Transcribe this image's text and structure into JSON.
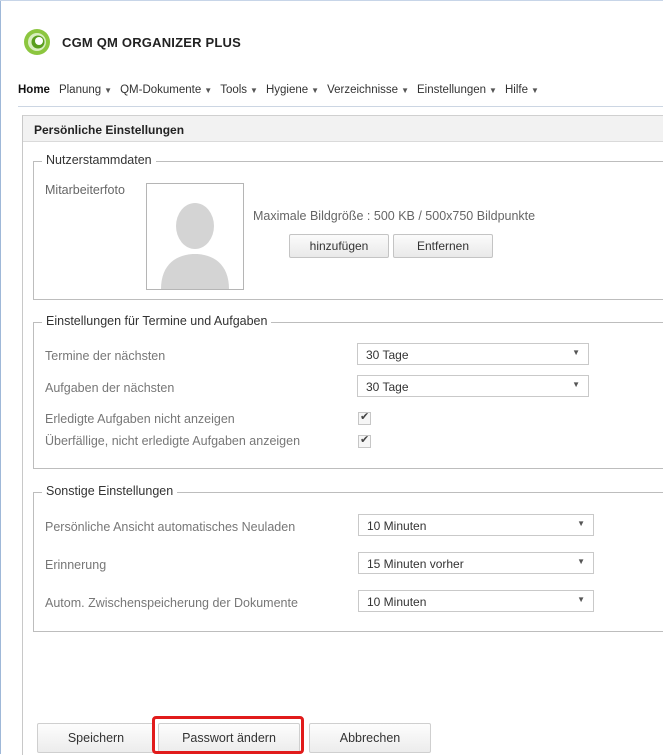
{
  "app": {
    "title": "CGM QM ORGANIZER PLUS"
  },
  "nav": [
    {
      "label": "Home",
      "has_menu": false
    },
    {
      "label": "Planung",
      "has_menu": true
    },
    {
      "label": "QM-Dokumente",
      "has_menu": true
    },
    {
      "label": "Tools",
      "has_menu": true
    },
    {
      "label": "Hygiene",
      "has_menu": true
    },
    {
      "label": "Verzeichnisse",
      "has_menu": true
    },
    {
      "label": "Einstellungen",
      "has_menu": true
    },
    {
      "label": "Hilfe",
      "has_menu": true
    }
  ],
  "panel": {
    "title": "Persönliche Einstellungen"
  },
  "user_data": {
    "legend": "Nutzerstammdaten",
    "photo_label": "Mitarbeiterfoto",
    "hint": "Maximale Bildgröße : 500 KB / 500x750 Bildpunkte",
    "add_button": "hinzufügen",
    "remove_button": "Entfernen"
  },
  "tasks": {
    "legend": "Einstellungen für Termine und Aufgaben",
    "appointments_label": "Termine der nächsten",
    "appointments_value": "30 Tage",
    "tasks_label": "Aufgaben der nächsten",
    "tasks_value": "30 Tage",
    "hide_done_label": "Erledigte Aufgaben nicht anzeigen",
    "hide_done_checked": true,
    "show_overdue_label": "Überfällige, nicht erledigte Aufgaben anzeigen",
    "show_overdue_checked": true
  },
  "other": {
    "legend": "Sonstige Einstellungen",
    "reload_label": "Persönliche Ansicht automatisches Neuladen",
    "reload_value": "10 Minuten",
    "reminder_label": "Erinnerung",
    "reminder_value": "15 Minuten vorher",
    "autosave_label": "Autom. Zwischenspeicherung der Dokumente",
    "autosave_value": "10 Minuten"
  },
  "actions": {
    "save": "Speichern",
    "change_password": "Passwort ändern",
    "cancel": "Abbrechen"
  },
  "colors": {
    "logo_green": "#8cc63f",
    "highlight_red": "#e11b1b"
  }
}
